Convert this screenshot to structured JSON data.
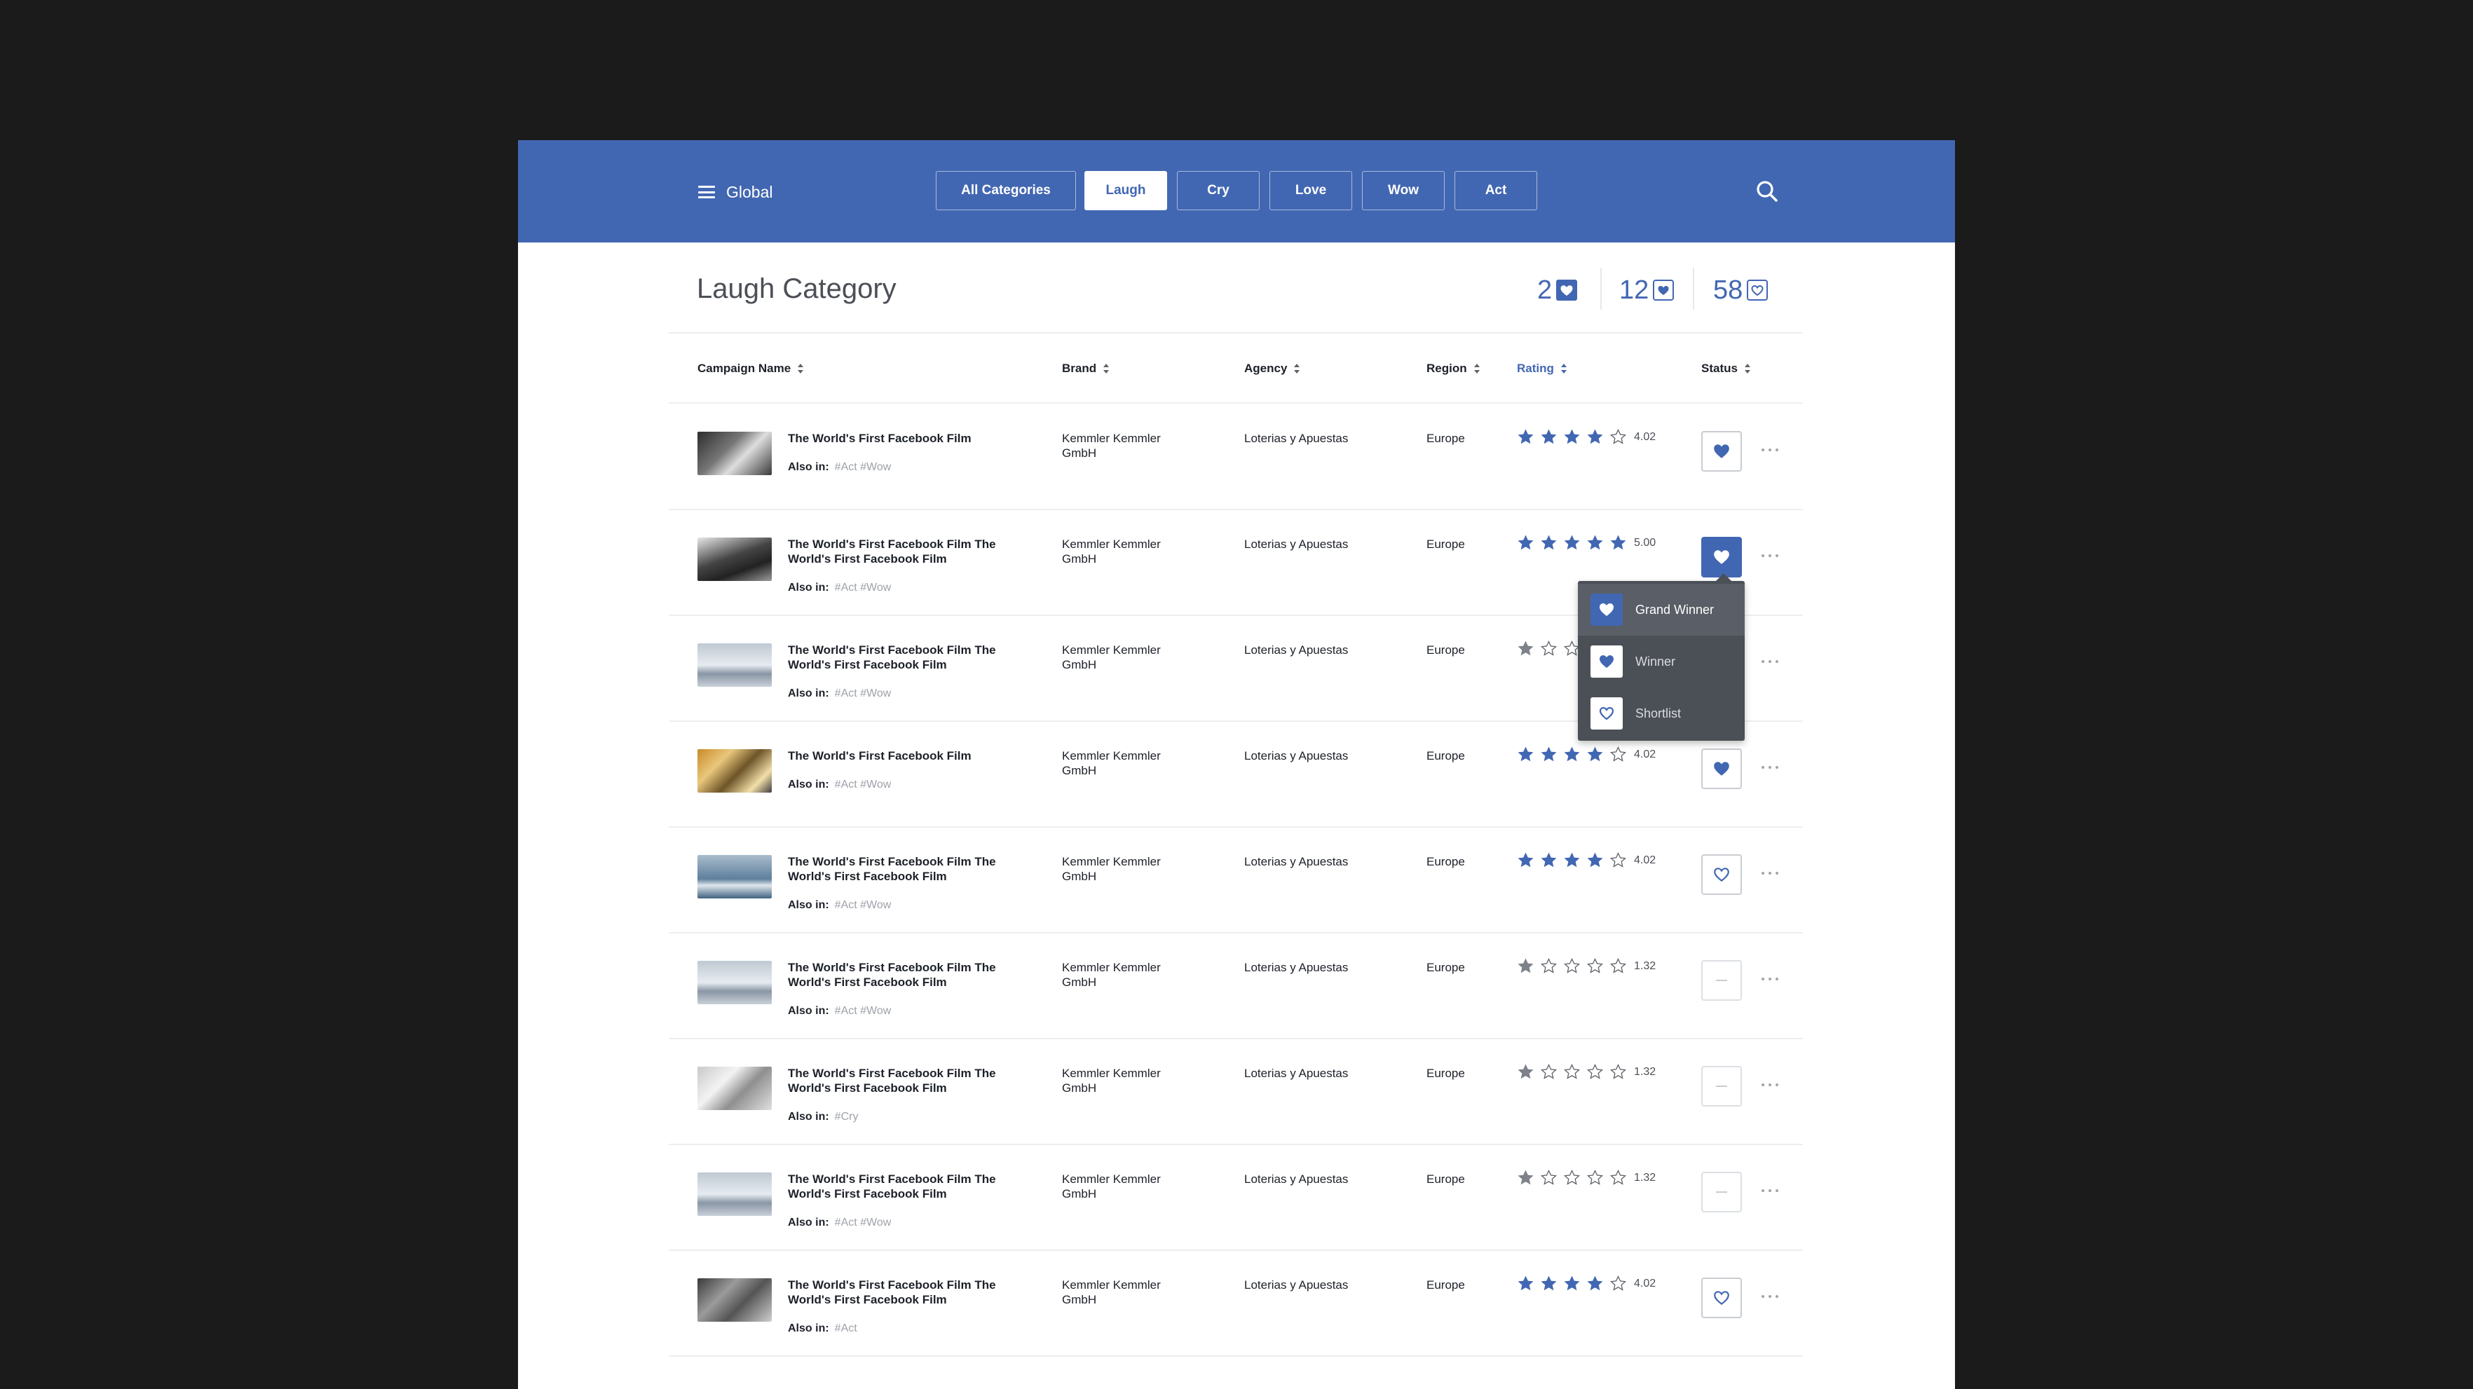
{
  "header": {
    "menu_label": "Global",
    "tabs": [
      {
        "label": "All Categories"
      },
      {
        "label": "Laugh"
      },
      {
        "label": "Cry"
      },
      {
        "label": "Love"
      },
      {
        "label": "Wow"
      },
      {
        "label": "Act"
      }
    ],
    "active_tab": "Laugh",
    "accent_color": "#4267b2"
  },
  "page": {
    "title": "Laugh Category",
    "counters": [
      {
        "value": "2",
        "icon": "heart-filled-icon"
      },
      {
        "value": "12",
        "icon": "heart-filled-icon"
      },
      {
        "value": "58",
        "icon": "heart-outline-icon"
      }
    ]
  },
  "table": {
    "columns": [
      "Campaign Name",
      "Brand",
      "Agency",
      "Region",
      "Rating",
      "Status"
    ],
    "sorted_column": "Rating",
    "also_label": "Also in:",
    "rows": [
      {
        "name": "The World's First Facebook Film",
        "tags": "#Act #Wow",
        "brand": "Kemmler Kemmler GmbH",
        "agency": "Loterias y Apuestas",
        "region": "Europe",
        "stars": 4,
        "rating": "4.02",
        "status": "winner"
      },
      {
        "name": "The World's First Facebook Film The World's First Facebook Film",
        "tags": "#Act #Wow",
        "brand": "Kemmler Kemmler GmbH",
        "agency": "Loterias y Apuestas",
        "region": "Europe",
        "stars": 5,
        "rating": "5.00",
        "status": "grand-winner"
      },
      {
        "name": "The World's First Facebook Film The World's First Facebook Film",
        "tags": "#Act #Wow",
        "brand": "Kemmler Kemmler GmbH",
        "agency": "Loterias y Apuestas",
        "region": "Europe",
        "stars": 1,
        "rating": "",
        "status": "none"
      },
      {
        "name": "The World's First Facebook Film",
        "tags": "#Act #Wow",
        "brand": "Kemmler Kemmler GmbH",
        "agency": "Loterias y Apuestas",
        "region": "Europe",
        "stars": 4,
        "rating": "4.02",
        "status": "winner"
      },
      {
        "name": "The World's First Facebook Film The World's First Facebook Film",
        "tags": "#Act #Wow",
        "brand": "Kemmler Kemmler GmbH",
        "agency": "Loterias y Apuestas",
        "region": "Europe",
        "stars": 4,
        "rating": "4.02",
        "status": "shortlist"
      },
      {
        "name": "The World's First Facebook Film The World's First Facebook Film",
        "tags": "#Act #Wow",
        "brand": "Kemmler Kemmler GmbH",
        "agency": "Loterias y Apuestas",
        "region": "Europe",
        "stars": 1,
        "rating": "1.32",
        "status": "none"
      },
      {
        "name": "The World's First Facebook Film The World's First Facebook Film",
        "tags": "#Cry",
        "brand": "Kemmler Kemmler GmbH",
        "agency": "Loterias y Apuestas",
        "region": "Europe",
        "stars": 1,
        "rating": "1.32",
        "status": "none"
      },
      {
        "name": "The World's First Facebook Film The World's First Facebook Film",
        "tags": "#Act #Wow",
        "brand": "Kemmler Kemmler GmbH",
        "agency": "Loterias y Apuestas",
        "region": "Europe",
        "stars": 1,
        "rating": "1.32",
        "status": "none"
      },
      {
        "name": "The World's First Facebook Film The World's First Facebook Film",
        "tags": "#Act",
        "brand": "Kemmler Kemmler GmbH",
        "agency": "Loterias y Apuestas",
        "region": "Europe",
        "stars": 4,
        "rating": "4.02",
        "status": "shortlist"
      }
    ]
  },
  "status_menu": {
    "items": [
      {
        "label": "Grand Winner",
        "icon": "heart-filled-icon"
      },
      {
        "label": "Winner",
        "icon": "heart-filled-icon"
      },
      {
        "label": "Shortlist",
        "icon": "heart-outline-icon"
      }
    ],
    "selected": "Grand Winner"
  }
}
